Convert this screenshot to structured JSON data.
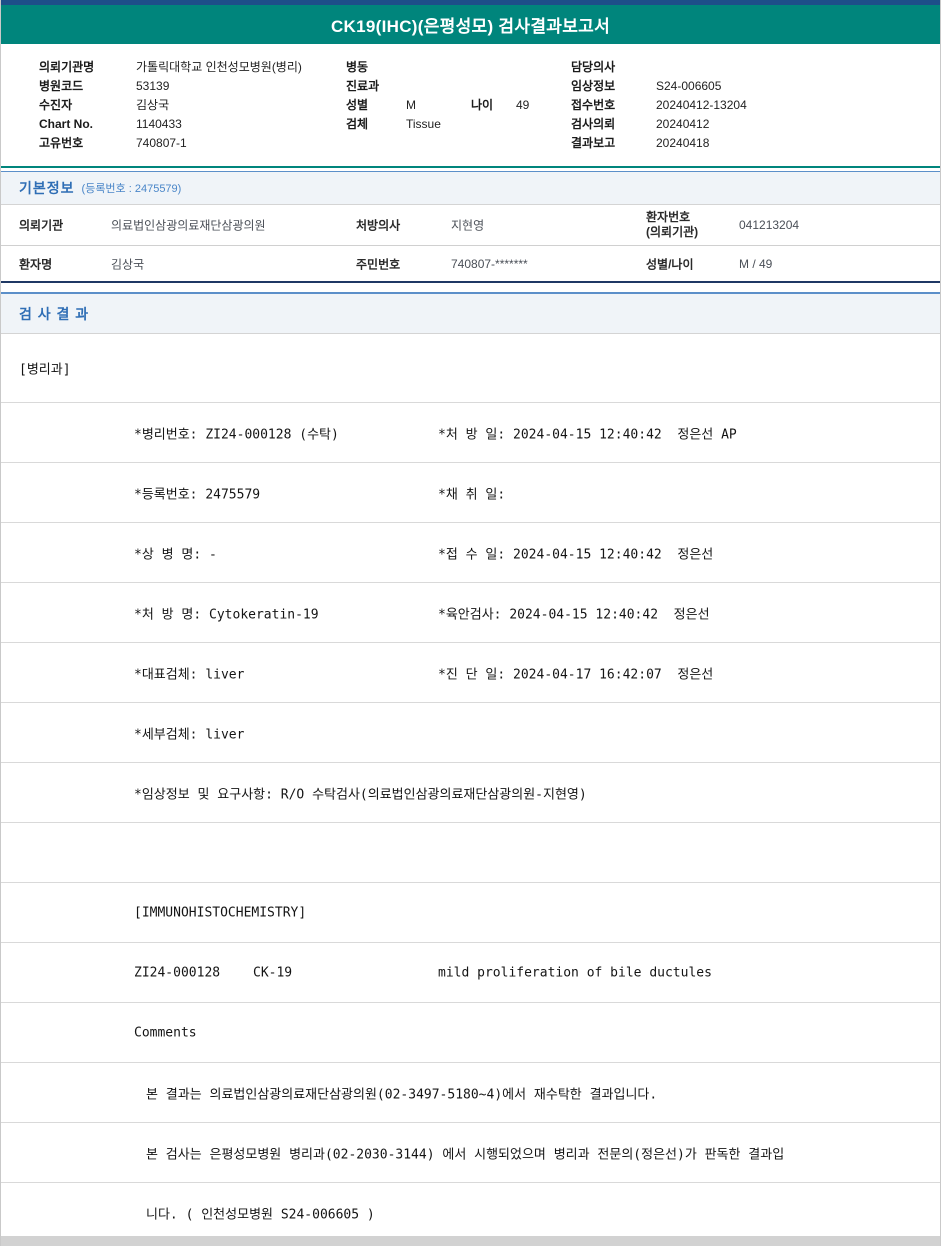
{
  "title_bar": {
    "title": "CK19(IHC)(은평성모) 검사결과보고서"
  },
  "colors": {
    "accent_teal": "#00857C",
    "section_blue": "#2F6EB5",
    "top_strip_navy": "#1D4E89",
    "table_bottom_navy": "#1F3864"
  },
  "header": {
    "left": [
      {
        "label": "의뢰기관명",
        "value": "가톨릭대학교 인천성모병원(병리)"
      },
      {
        "label": "병원코드",
        "value": "53139"
      },
      {
        "label": "수진자",
        "value": "김상국"
      },
      {
        "label": "Chart No.",
        "value": "1140433"
      },
      {
        "label": "고유번호",
        "value": "740807-1"
      }
    ],
    "middle": [
      {
        "label": "병동",
        "value": ""
      },
      {
        "label": "진료과",
        "value": ""
      },
      {
        "label": "성별",
        "value": "M"
      },
      {
        "label": "검체",
        "value": "Tissue"
      }
    ],
    "age": {
      "label": "나이",
      "value": "49"
    },
    "right": [
      {
        "label": "담당의사",
        "value": ""
      },
      {
        "label": "임상정보",
        "value": "S24-006605"
      },
      {
        "label": "접수번호",
        "value": "20240412-13204"
      },
      {
        "label": "검사의뢰",
        "value": "20240412"
      },
      {
        "label": "결과보고",
        "value": "20240418"
      }
    ]
  },
  "basic_info": {
    "title": "기본정보",
    "subtitle": "(등록번호 : 2475579)",
    "row1": [
      {
        "label": "의뢰기관",
        "value": "의료법인삼광의료재단삼광의원"
      },
      {
        "label": "처방의사",
        "value": "지현영"
      },
      {
        "label": "환자번호\n(의뢰기관)",
        "value": "041213204"
      }
    ],
    "row2": [
      {
        "label": "환자명",
        "value": "김상국"
      },
      {
        "label": "주민번호",
        "value": "740807-*******"
      },
      {
        "label": "성별/나이",
        "value": "M / 49"
      }
    ]
  },
  "results": {
    "title": "검 사 결 과",
    "department": "[병리과]",
    "details": [
      {
        "left": "*병리번호: ZI24-000128 (수탁)",
        "right": "*처 방 일: 2024-04-15 12:40:42  정은선 AP"
      },
      {
        "left": "*등록번호: 2475579",
        "right": "*채 취 일:"
      },
      {
        "left": "*상 병 명: -",
        "right": "*접 수 일: 2024-04-15 12:40:42  정은선"
      },
      {
        "left": "*처 방 명: Cytokeratin-19",
        "right": "*육안검사: 2024-04-15 12:40:42  정은선"
      },
      {
        "left": "*대표검체: liver",
        "right": "*진 단 일: 2024-04-17 16:42:07  정은선"
      },
      {
        "left": "*세부검체: liver",
        "right": ""
      },
      {
        "left": "*임상정보 및 요구사항: R/O 수탁검사(의료법인삼광의료재단삼광의원-지현영)",
        "right": ""
      }
    ],
    "ihc": {
      "header": "[IMMUNOHISTOCHEMISTRY]",
      "code": "ZI24-000128",
      "test": "CK-19",
      "result": "mild proliferation of bile ductules"
    },
    "comments_label": "Comments",
    "comments": [
      "본 결과는 의료법인삼광의료재단삼광의원(02-3497-5180~4)에서 재수탁한 결과입니다.",
      "본 검사는 은평성모병원 병리과(02-2030-3144) 에서 시행되었으며 병리과 전문의(정은선)가 판독한 결과입",
      "니다. ( 인천성모병원 S24-006605 )"
    ]
  }
}
